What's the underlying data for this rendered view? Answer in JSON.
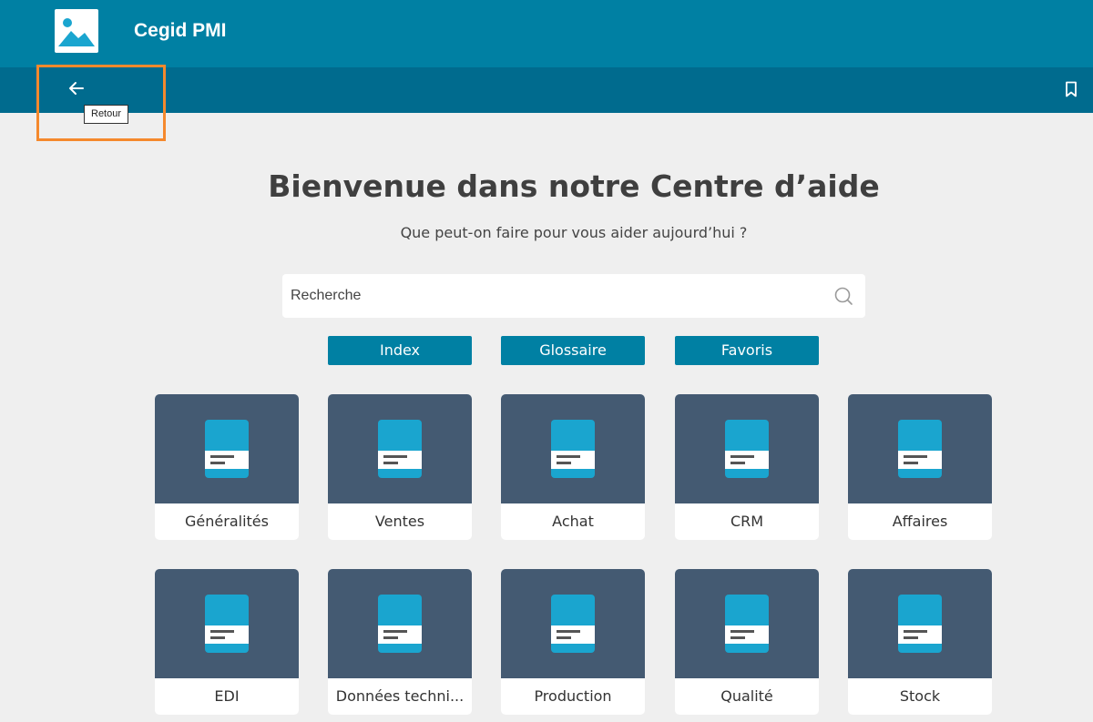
{
  "header": {
    "app_title": "Cegid PMI",
    "logo_icon": "image-placeholder-icon",
    "background": "#0080a3"
  },
  "toolbar": {
    "background": "#006b8e",
    "back_icon": "arrow-left-icon",
    "back_tooltip": "Retour",
    "bookmark_icon": "bookmark-icon"
  },
  "main": {
    "title": "Bienvenue dans notre Centre d’aide",
    "subtitle": "Que peut-on faire pour vous aider aujourd’hui ?",
    "search": {
      "placeholder": "Recherche",
      "icon": "search-icon"
    },
    "buttons": [
      "Index",
      "Glossaire",
      "Favoris"
    ],
    "tiles": [
      "Généralités",
      "Ventes",
      "Achat",
      "CRM",
      "Affaires",
      "EDI",
      "Données techni...",
      "Production",
      "Qualité",
      "Stock"
    ],
    "tile_icon": "book-icon",
    "tile_color": "#445a72",
    "accent": "#0080a3",
    "highlight_color": "#f5892d"
  }
}
